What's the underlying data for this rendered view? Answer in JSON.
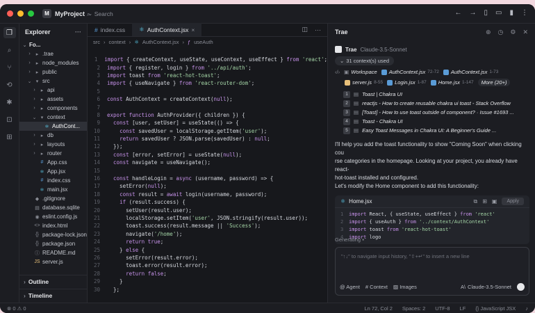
{
  "titlebar": {
    "project_badge": "M",
    "project_name": "MyProject",
    "search_placeholder": "Search",
    "traffic_colors": [
      "#ff5f57",
      "#febc2e",
      "#28c840"
    ]
  },
  "explorer": {
    "title": "Explorer",
    "more": "···",
    "root": "Fo...",
    "items": [
      {
        "label": ".trae",
        "arrow": "›",
        "icon": "▸",
        "indent": 1
      },
      {
        "label": "node_modules",
        "arrow": "›",
        "icon": "▸",
        "indent": 1
      },
      {
        "label": "public",
        "arrow": "›",
        "icon": "▸",
        "indent": 1
      },
      {
        "label": "src",
        "arrow": "⌄",
        "icon": "▾",
        "indent": 1
      },
      {
        "label": "api",
        "arrow": "›",
        "icon": "▸",
        "indent": 2
      },
      {
        "label": "assets",
        "arrow": "›",
        "icon": "▸",
        "indent": 2
      },
      {
        "label": "components",
        "arrow": "›",
        "icon": "▸",
        "indent": 2
      },
      {
        "label": "context",
        "arrow": "⌄",
        "icon": "▾",
        "indent": 2
      },
      {
        "label": "AuthCont...",
        "arrow": "",
        "icon": "⚛",
        "indent": 3,
        "selected": true
      },
      {
        "label": "db",
        "arrow": "›",
        "icon": "▸",
        "indent": 2
      },
      {
        "label": "layouts",
        "arrow": "›",
        "icon": "▸",
        "indent": 2
      },
      {
        "label": "router",
        "arrow": "›",
        "icon": "▸",
        "indent": 2
      },
      {
        "label": "App.css",
        "arrow": "",
        "icon": "#",
        "indent": 2
      },
      {
        "label": "App.jsx",
        "arrow": "",
        "icon": "⚛",
        "indent": 2
      },
      {
        "label": "index.css",
        "arrow": "",
        "icon": "#",
        "indent": 2
      },
      {
        "label": "main.jsx",
        "arrow": "",
        "icon": "⚛",
        "indent": 2
      },
      {
        "label": ".gitignore",
        "arrow": "",
        "icon": "◆",
        "indent": 1
      },
      {
        "label": "database.sqlite",
        "arrow": "",
        "icon": "▤",
        "indent": 1
      },
      {
        "label": "eslint.config.js",
        "arrow": "",
        "icon": "◉",
        "indent": 1
      },
      {
        "label": "index.html",
        "arrow": "",
        "icon": "<>",
        "indent": 1
      },
      {
        "label": "package-lock.json",
        "arrow": "",
        "icon": "{}",
        "indent": 1
      },
      {
        "label": "package.json",
        "arrow": "",
        "icon": "{}",
        "indent": 1
      },
      {
        "label": "README.md",
        "arrow": "",
        "icon": "ⓘ",
        "indent": 1
      },
      {
        "label": "server.js",
        "arrow": "",
        "icon": "JS",
        "indent": 1
      }
    ],
    "outline": "Outline",
    "timeline": "Timeline"
  },
  "editor": {
    "tabs": [
      {
        "label": "index.css",
        "icon": "#",
        "active": false
      },
      {
        "label": "AuthContext.jsx",
        "icon": "⚛",
        "active": true
      }
    ],
    "close": "×",
    "breadcrumb": [
      "src",
      "context",
      "AuthContext.jsx",
      "useAuth"
    ],
    "lines": [
      {
        "n": "1",
        "code": "import { createContext, useState, useContext, useEffect } from 'react';"
      },
      {
        "n": "2",
        "code": "import { register, login } from '../api/auth';"
      },
      {
        "n": "3",
        "code": "import toast from 'react-hot-toast';"
      },
      {
        "n": "4",
        "code": "import { useNavigate } from 'react-router-dom';"
      },
      {
        "n": "5",
        "code": ""
      },
      {
        "n": "6",
        "code": "const AuthContext = createContext(null);"
      },
      {
        "n": "7",
        "code": ""
      },
      {
        "n": "8",
        "code": "export function AuthProvider({ children }) {"
      },
      {
        "n": "9",
        "code": "  const [user, setUser] = useState(() => {"
      },
      {
        "n": "10",
        "code": "    const savedUser = localStorage.getItem('user');"
      },
      {
        "n": "11",
        "code": "    return savedUser ? JSON.parse(savedUser) : null;"
      },
      {
        "n": "12",
        "code": "  });"
      },
      {
        "n": "13",
        "code": "  const [error, setError] = useState(null);"
      },
      {
        "n": "14",
        "code": "  const navigate = useNavigate();"
      },
      {
        "n": "15",
        "code": ""
      },
      {
        "n": "16",
        "code": "  const handleLogin = async (username, password) => {"
      },
      {
        "n": "17",
        "code": "    setError(null);"
      },
      {
        "n": "18",
        "code": "    const result = await login(username, password);"
      },
      {
        "n": "19",
        "code": "    if (result.success) {"
      },
      {
        "n": "20",
        "code": "      setUser(result.user);"
      },
      {
        "n": "21",
        "code": "      localStorage.setItem('user', JSON.stringify(result.user));"
      },
      {
        "n": "22",
        "code": "      toast.success(result.message || 'Success');"
      },
      {
        "n": "23",
        "code": "      navigate('/home');"
      },
      {
        "n": "24",
        "code": "      return true;"
      },
      {
        "n": "25",
        "code": "    } else {"
      },
      {
        "n": "26",
        "code": "      setError(result.error);"
      },
      {
        "n": "27",
        "code": "      toast.error(result.error);"
      },
      {
        "n": "28",
        "code": "      return false;"
      },
      {
        "n": "29",
        "code": "    }"
      },
      {
        "n": "30",
        "code": "  };"
      }
    ]
  },
  "ai": {
    "title": "Trae",
    "model_name": "Trae",
    "model_version": "Claude-3.5-Sonnet",
    "context_pill": "31 context(s) used",
    "refs": [
      {
        "label": "Workspace",
        "num": ""
      },
      {
        "label": "AuthContext.jsx",
        "num": "72-72"
      },
      {
        "label": "AuthContext.jsx",
        "num": "1-73"
      }
    ],
    "refs2": [
      {
        "label": "server.js",
        "num": "8-55"
      },
      {
        "label": "Login.jsx",
        "num": "1-87"
      },
      {
        "label": "Home.jsx",
        "num": "1-147"
      }
    ],
    "more": "More (20+)",
    "web_results": [
      {
        "n": "1",
        "label": "Toast | Chakra UI"
      },
      {
        "n": "2",
        "label": "reactjs - How to create reusable chakra ui toast - Stack Overflow"
      },
      {
        "n": "3",
        "label": "[Toast] - How to use toast outside of component? · Issue #1693 ..."
      },
      {
        "n": "4",
        "label": "Toast - Chakra UI"
      },
      {
        "n": "5",
        "label": "Easy Toast Messages in Chakra UI: A Beginner's Guide ..."
      }
    ],
    "answer": [
      "I'll help you add the toast functionality to show \"Coming Soon\" when clicking cou",
      "rse categories in the homepage. Looking at your project, you already have react-",
      "hot-toast installed and configured.",
      "Let's modify the Home component to add this functionality:"
    ],
    "codeblock": {
      "file": "Home.jsx",
      "apply": "Apply",
      "lines": [
        {
          "n": "1",
          "code": "import React, { useState, useEffect } from 'react'"
        },
        {
          "n": "2",
          "code": "import { useAuth } from '../context/AuthContext'"
        },
        {
          "n": "3",
          "code": "import toast from 'react-hot-toast'"
        },
        {
          "n": "4",
          "code": "import logo"
        }
      ]
    },
    "generating": "Generating ▪",
    "input_placeholder": "\"↑↓\" to navigate input history, \"⇧+↵\" to insert a new line",
    "agent": "Agent",
    "context": "Context",
    "images": "Images",
    "model_select": "Claude-3.5-Sonnet"
  },
  "statusbar": {
    "left": "⊗ 0  ⚠ 0",
    "position": "Ln 72, Col 2",
    "spaces": "Spaces: 2",
    "encoding": "UTF-8",
    "eol": "LF",
    "language": "{} JavaScript JSX",
    "bell": "🔔"
  }
}
